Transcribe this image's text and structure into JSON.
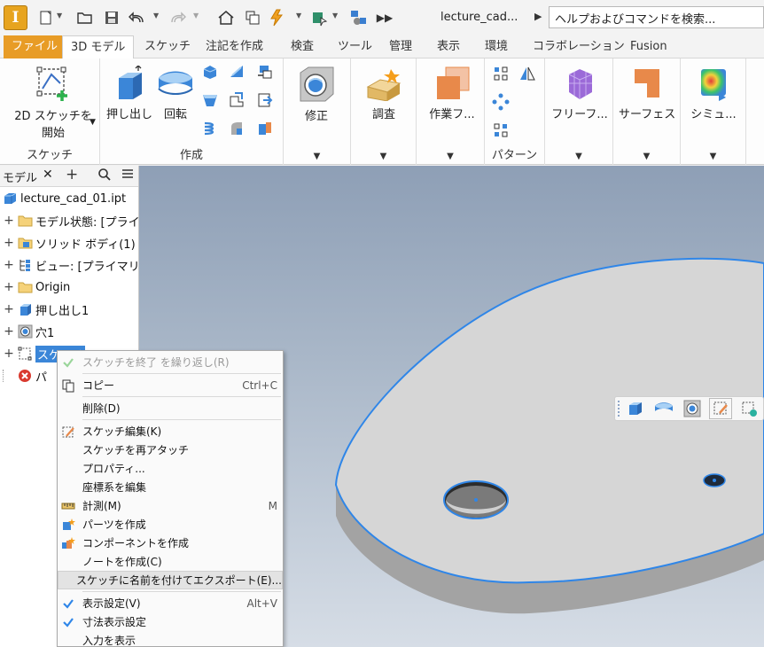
{
  "quick_access": {
    "app_letter": "I",
    "doc_title": "lecture_cad...",
    "search_text": "ヘルプおよびコマンドを検索...",
    "icons": [
      "new-file-icon",
      "open-folder-icon",
      "save-icon",
      "undo-icon",
      "redo-icon",
      "home-icon",
      "projects-icon",
      "update-icon",
      "select-icon",
      "share-icon",
      "more-icon"
    ]
  },
  "tabs": [
    "ファイル",
    "3D モデル",
    "スケッチ",
    "注記を作成",
    "検査",
    "ツール",
    "管理",
    "表示",
    "環境",
    "コラボレーション",
    "Fusion"
  ],
  "ribbon": {
    "sketch_button_line1": "2D スケッチを",
    "sketch_button_line2": "開始",
    "sketch_panel": "スケッチ",
    "extrude": "押し出し",
    "revolve": "回転",
    "create_panel": "作成",
    "modify": "修正",
    "inspect": "調査",
    "work_features": "作業フ...",
    "pattern_panel": "パターン",
    "freeform": "フリーフ...",
    "surface": "サーフェス",
    "simulation": "シミュ...",
    "colors": {
      "orange": "#e8894a",
      "blue": "#3b82d0",
      "purple": "#9b6ad8",
      "green": "#2bb24c"
    }
  },
  "browser": {
    "tab_label": "モデル",
    "items": [
      {
        "label": "lecture_cad_01.ipt",
        "icon": "part-icon"
      },
      {
        "label": "モデル状態: [プライ",
        "icon": "folder-icon"
      },
      {
        "label": "ソリッド ボディ(1)",
        "icon": "solid-body-folder-icon"
      },
      {
        "label": "ビュー: [プライマリ]",
        "icon": "view-icon"
      },
      {
        "label": "Origin",
        "icon": "folder-icon"
      },
      {
        "label": "押し出し1",
        "icon": "extrude-icon"
      },
      {
        "label": "穴1",
        "icon": "hole-icon"
      },
      {
        "label": "スケッチ",
        "icon": "sketch-icon"
      },
      {
        "label": "パ",
        "icon": "error-icon"
      }
    ]
  },
  "context_menu": {
    "items": [
      {
        "label": "スケッチを終了 を繰り返し(R)",
        "shortcut": "",
        "icon": "check-icon",
        "disabled": true
      },
      {
        "label": "コピー",
        "shortcut": "Ctrl+C",
        "icon": "copy-icon"
      },
      {
        "label": "削除(D)",
        "shortcut": "",
        "icon": ""
      },
      {
        "label": "スケッチ編集(K)",
        "shortcut": "",
        "icon": "edit-sketch-icon"
      },
      {
        "label": "スケッチを再アタッチ",
        "shortcut": "",
        "icon": ""
      },
      {
        "label": "プロパティ...",
        "shortcut": "",
        "icon": ""
      },
      {
        "label": "座標系を編集",
        "shortcut": "",
        "icon": ""
      },
      {
        "label": "計測(M)",
        "shortcut": "M",
        "icon": "measure-icon"
      },
      {
        "label": "パーツを作成",
        "shortcut": "",
        "icon": "make-part-icon"
      },
      {
        "label": "コンポーネントを作成",
        "shortcut": "",
        "icon": "make-component-icon"
      },
      {
        "label": "ノートを作成(C)",
        "shortcut": "",
        "icon": ""
      },
      {
        "label": "スケッチに名前を付けてエクスポート(E)...",
        "shortcut": "",
        "icon": "",
        "highlighted": true
      },
      {
        "label": "表示設定(V)",
        "shortcut": "Alt+V",
        "icon": "check-icon"
      },
      {
        "label": "寸法表示設定",
        "shortcut": "",
        "icon": "check-icon"
      },
      {
        "label": "入力を表示",
        "shortcut": "",
        "icon": ""
      }
    ]
  },
  "mini_toolbar": {
    "icons": [
      "extrude-icon",
      "revolve-icon",
      "hole-icon",
      "edit-sketch-icon",
      "sketch-dims-icon"
    ]
  }
}
